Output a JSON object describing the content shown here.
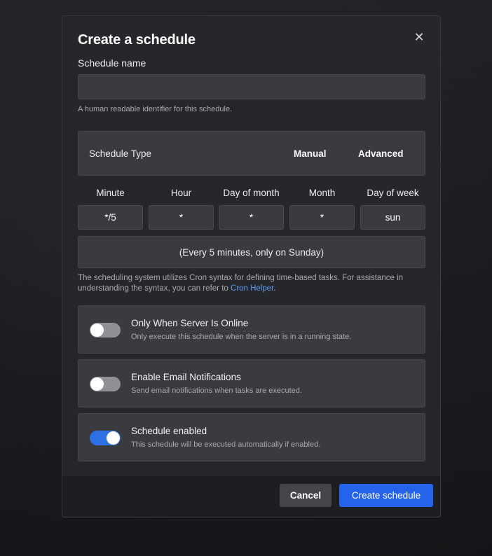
{
  "modal": {
    "title": "Create a schedule",
    "close_glyph": "✕"
  },
  "schedule_name": {
    "label": "Schedule name",
    "value": "",
    "placeholder": "",
    "helper": "A human readable identifier for this schedule."
  },
  "schedule_type": {
    "label": "Schedule Type",
    "options": [
      "Manual",
      "Advanced"
    ]
  },
  "cron": {
    "columns": [
      {
        "label": "Minute",
        "value": "*/5"
      },
      {
        "label": "Hour",
        "value": "*"
      },
      {
        "label": "Day of month",
        "value": "*"
      },
      {
        "label": "Month",
        "value": "*"
      },
      {
        "label": "Day of week",
        "value": "sun"
      }
    ],
    "summary": "(Every 5 minutes, only on Sunday)",
    "help_text": "The scheduling system utilizes Cron syntax for defining time-based tasks. For assistance in understanding the syntax, you can refer to ",
    "help_link": "Cron Helper",
    "help_end": "."
  },
  "toggles": [
    {
      "title": "Only When Server Is Online",
      "description": "Only execute this schedule when the server is in a running state.",
      "on": false
    },
    {
      "title": "Enable Email Notifications",
      "description": "Send email notifications when tasks are executed.",
      "on": false
    },
    {
      "title": "Schedule enabled",
      "description": "This schedule will be executed automatically if enabled.",
      "on": true
    }
  ],
  "footer": {
    "cancel_label": "Cancel",
    "create_label": "Create schedule"
  },
  "colors": {
    "accent": "#2563eb",
    "toggle_on": "#2f6fe4",
    "link": "#5b9bf5"
  },
  "icons": {
    "close": "close-icon"
  }
}
